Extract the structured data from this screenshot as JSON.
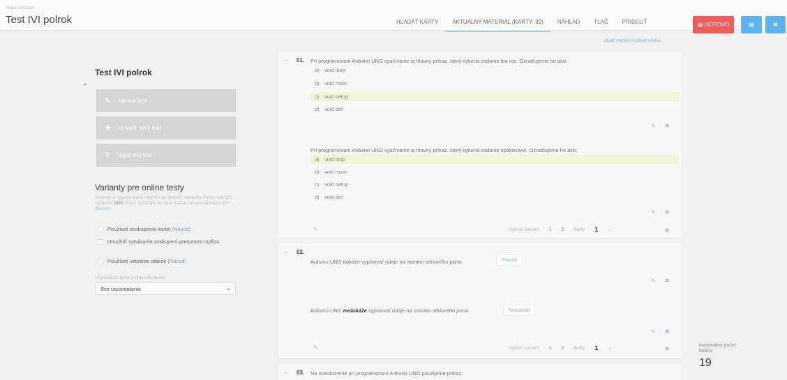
{
  "header": {
    "breadcrumb": "Práca s testami",
    "title": "Test IVI polrok",
    "tabs": [
      {
        "label": "HĽADAŤ KARTY",
        "active": false
      },
      {
        "label": "AKTUÁLNY MATERIÁL (KARTY: 32)",
        "active": true
      },
      {
        "label": "NÁHĽAD",
        "active": false
      },
      {
        "label": "TLAČ",
        "active": false
      },
      {
        "label": "PRIDELIŤ",
        "active": false
      }
    ],
    "done_label": "HOTOVO",
    "colors": {
      "done": "#f05b5b",
      "save": "#5cb3f0",
      "close": "#5cb3f0"
    },
    "icons": {
      "done": "save-icon",
      "save": "save-icon",
      "close": "close-icon"
    }
  },
  "expand_links": "Zbaliť všetko | Rozbaliť všetko",
  "sidebar": {
    "test_name": "Test IVI polrok",
    "buttons": [
      {
        "label": "Upraviť test",
        "icon": "pencil-icon"
      },
      {
        "label": "Vytvoriť nový test",
        "icon": "plus-icon"
      },
      {
        "label": "Nájsť môj test",
        "icon": "search-icon"
      }
    ],
    "variants_title": "Varianty pre online testy",
    "variants_desc_1": "Varianty sú vygenerované náhodne pri otvorení materiálu. Počet možných variantov: ",
    "variants_count": "5182",
    "variants_desc_2": ". Pozn. vytvárajte dostatok otázok náhodne pomiešaných ",
    "variants_link": "(Návod)",
    "options": [
      {
        "text": "Používať zoskupenia kariet",
        "link": "(Návod)"
      },
      {
        "text": "Umožniť vytváranie zoskupení presunom myšou",
        "link": ""
      },
      {
        "text": "Používať vetvenie otázok",
        "link": "(Návod)"
      }
    ],
    "sort_label": "Usporiadať otázky podľa počtu bodov",
    "sort_value": "Bez usporiadania"
  },
  "questions": [
    {
      "number": "01.",
      "variants": [
        {
          "text": "Pri programovaní Arduino UNO využívame aj hlavný príkaz, ktorý vykoná zadanie iba raz. Označujeme ho ako:",
          "answers": [
            {
              "letter": "a)",
              "text": "void loop",
              "correct": false
            },
            {
              "letter": "b)",
              "text": "void main",
              "correct": false
            },
            {
              "letter": "c)",
              "text": "void setup",
              "correct": true
            },
            {
              "letter": "d)",
              "text": "void def",
              "correct": false
            }
          ]
        },
        {
          "text": "Pri programovaní Arduino UNO využívame aj hlavný príkaz, ktorý vykoná zadanie opakovane. Označujeme ho ako:",
          "answers": [
            {
              "letter": "a)",
              "text": "void loop",
              "correct": true
            },
            {
              "letter": "b)",
              "text": "void main",
              "correct": false
            },
            {
              "letter": "c)",
              "text": "void setup",
              "correct": false
            },
            {
              "letter": "d)",
              "text": "void def",
              "correct": false
            }
          ]
        }
      ],
      "pager": {
        "label": "Vybrať variant",
        "p1": "1",
        "p2": "2",
        "points_label": "Body",
        "points": "1"
      }
    },
    {
      "number": "02.",
      "variants": [
        {
          "text_before": "Arduino UNO dokáže vypisovať údaje na monitor sériového portu.",
          "answer": "Pravda"
        },
        {
          "text_before": "Arduino UNO ",
          "bold": "nedokáže",
          "text_after": " vypisovať údaje na monitor sériového portu.",
          "answer": "Nepravda"
        }
      ],
      "pager": {
        "label": "Vybrať variant",
        "p1": "1",
        "p2": "2",
        "points_label": "Body",
        "points": "1"
      }
    },
    {
      "number": "03.",
      "text": "Na oneskorenie pri programovaní Arduino UNO použijeme príkaz:"
    }
  ],
  "max_points": {
    "label": "maximálny počet bodov",
    "value": "19"
  }
}
